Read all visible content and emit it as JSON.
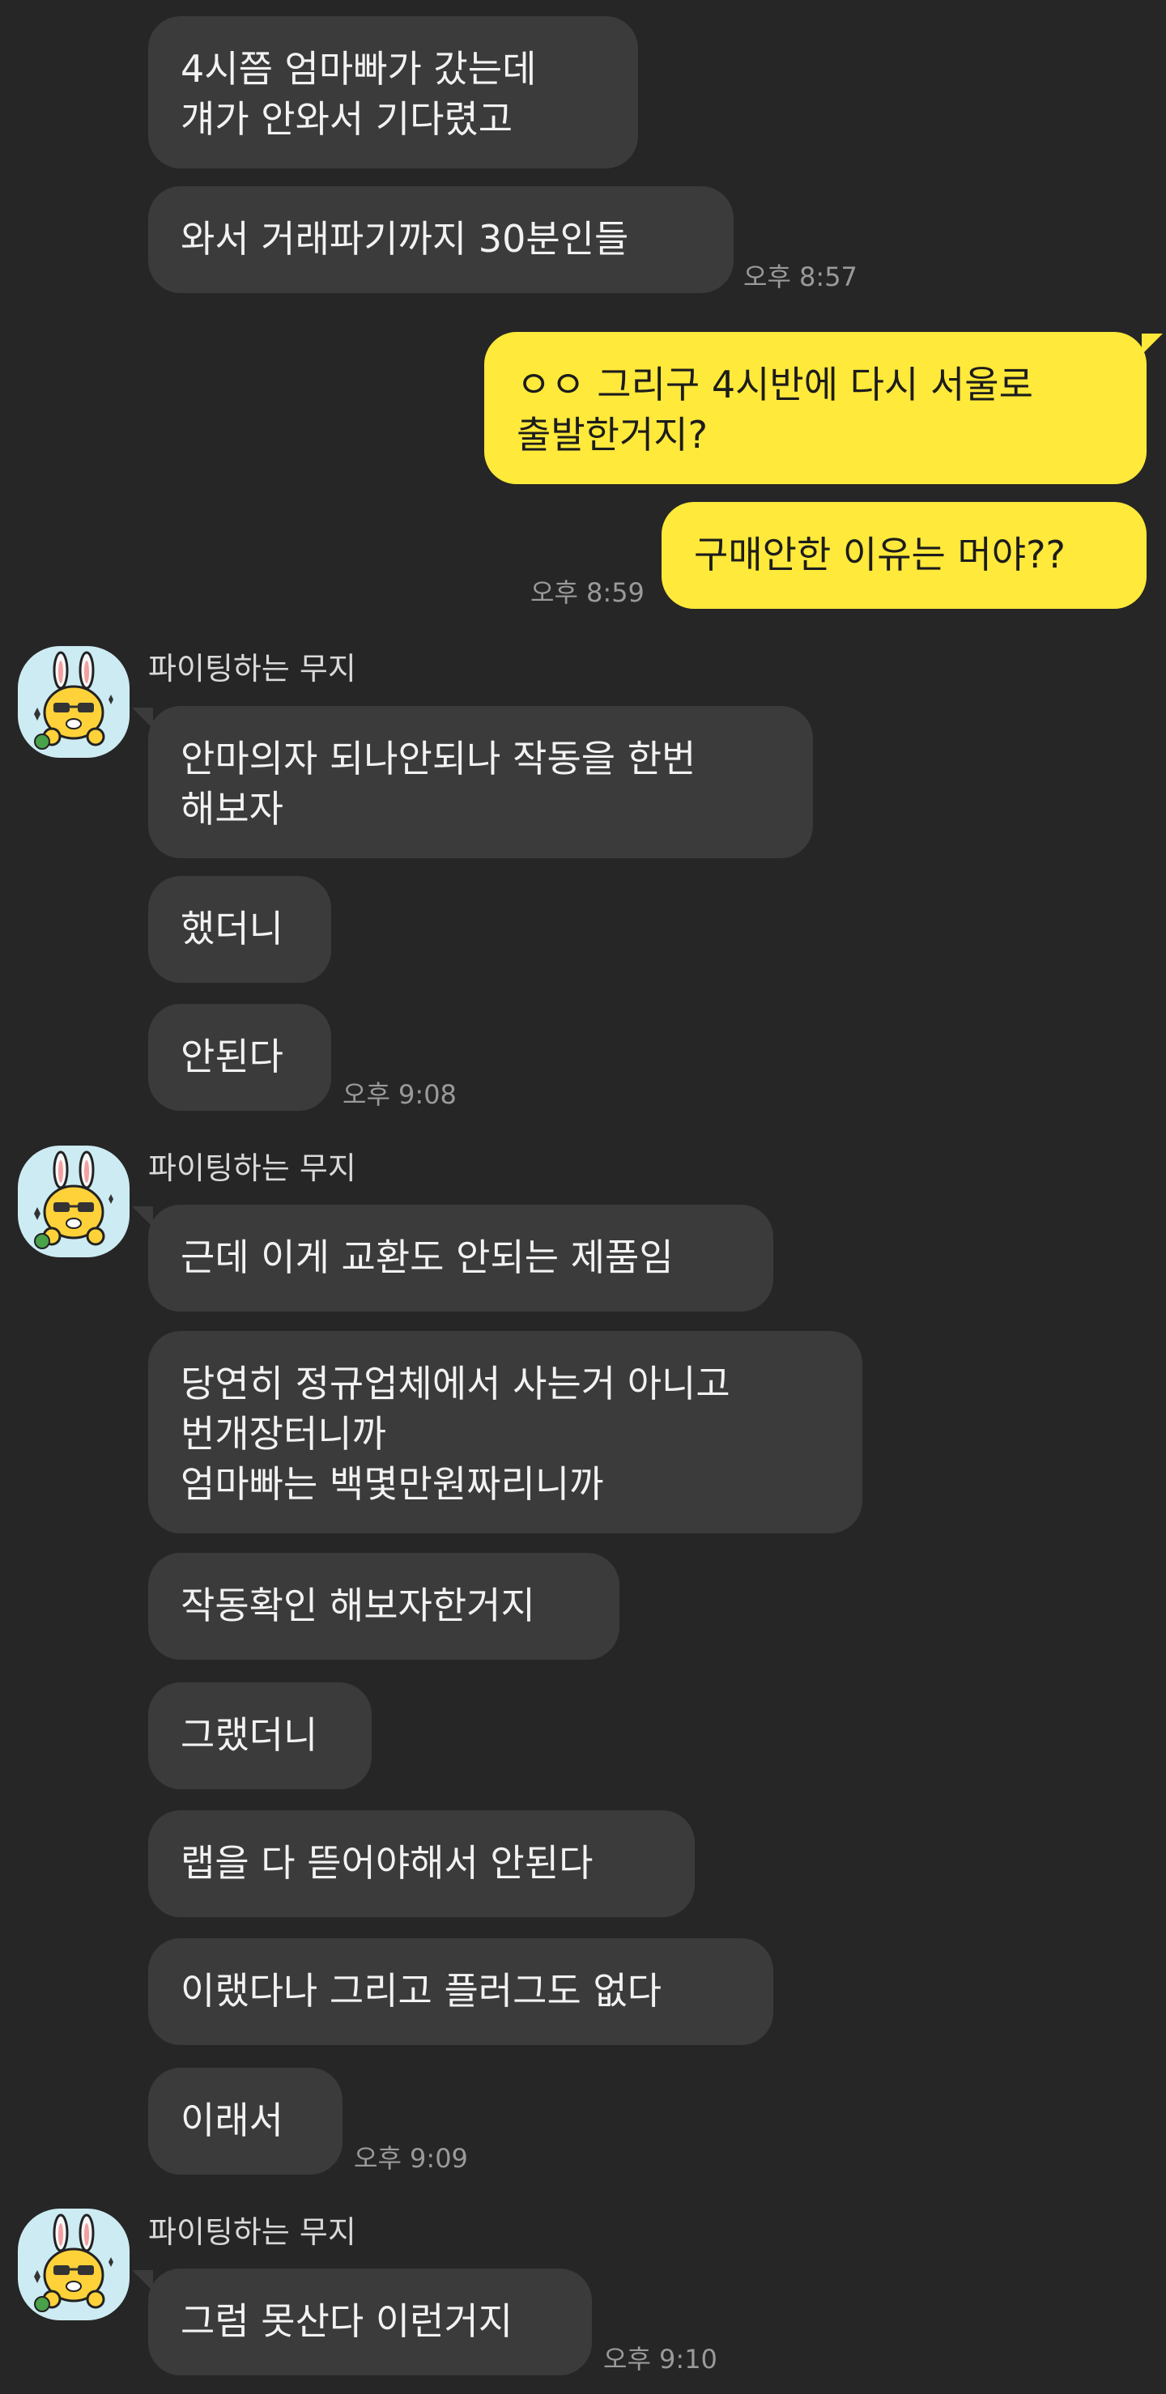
{
  "sender_name": "파이팅하는 무지",
  "messages": {
    "m1": "4시쯤 엄마빠가 갔는데\n걔가 안와서 기다렸고",
    "m2": "와서 거래파기까지 30분인들",
    "m3": "ㅇㅇ 그리구 4시반에 다시 서울로\n출발한거지?",
    "m4": "구매안한 이유는 머야??",
    "m5": "안마의자 되나안되나 작동을 한번\n해보자",
    "m6": "했더니",
    "m7": "안된다",
    "m8": "근데 이게 교환도 안되는 제품임",
    "m9": "당연히 정규업체에서 사는거 아니고\n번개장터니까\n엄마빠는 백몇만원짜리니까",
    "m10": "작동확인 해보자한거지",
    "m11": "그랬더니",
    "m12": "랩을 다 뜯어야해서 안된다",
    "m13": "이랬다나 그리고 플러그도 없다",
    "m14": "이래서",
    "m15": "그럼 못산다 이런거지"
  },
  "times": {
    "t1": "오후 8:57",
    "t2": "오후 8:59",
    "t3": "오후 9:08",
    "t4": "오후 9:09",
    "t5": "오후 9:10"
  },
  "colors": {
    "background": "#262626",
    "bubble_other": "#3b3b3b",
    "bubble_mine": "#ffe93a",
    "avatar_bg": "#cdebf2"
  },
  "avatar_icon": "muzi-character-icon"
}
